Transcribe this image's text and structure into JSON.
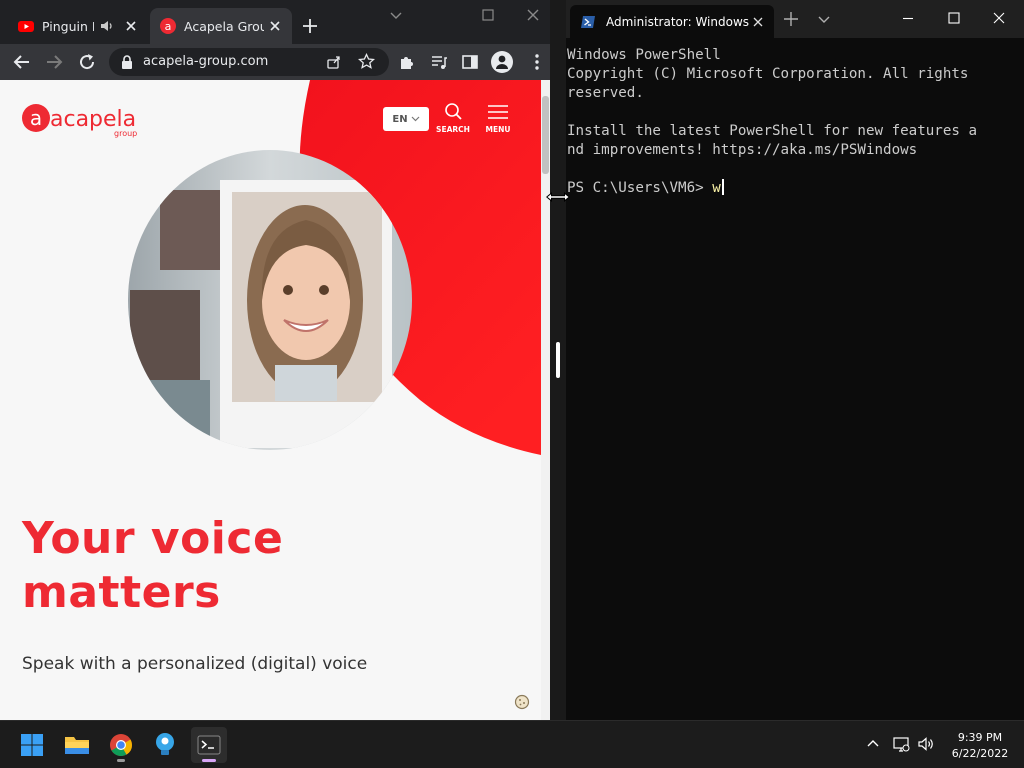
{
  "chrome": {
    "tabs": [
      {
        "title": "Pinguin N",
        "favicon": "youtube-icon",
        "audio": true
      },
      {
        "title": "Acapela Group",
        "favicon": "acapela-icon",
        "audio": false
      }
    ],
    "url": "acapela-group.com"
  },
  "webpage": {
    "logo_text": "acapela",
    "logo_sub": "group",
    "language": "EN",
    "search_label": "SEARCH",
    "menu_label": "MENU",
    "headline_line1": "Your voice",
    "headline_line2": "matters",
    "subheadline": "Speak with a personalized (digital) voice"
  },
  "terminal": {
    "tab_title": "Administrator: Windows P",
    "lines": [
      "Windows PowerShell",
      "Copyright (C) Microsoft Corporation. All rights",
      "reserved.",
      "",
      "Install the latest PowerShell for new features a",
      "nd improvements! https://aka.ms/PSWindows",
      ""
    ],
    "prompt": "PS C:\\Users\\VM6> ",
    "typed": "w"
  },
  "taskbar": {
    "apps": [
      "start-icon",
      "file-explorer-icon",
      "chrome-icon",
      "tips-icon",
      "terminal-icon"
    ],
    "time": "9:39 PM",
    "date": "6/22/2022"
  },
  "colors": {
    "brand_red": "#ee2a33",
    "terminal_bg": "#0c0c0c",
    "chrome_dark": "#202124"
  }
}
